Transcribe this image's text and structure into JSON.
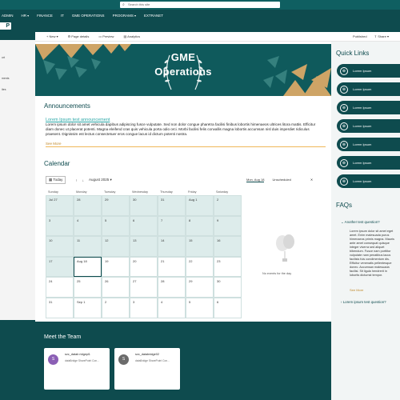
{
  "topbar": {
    "search_placeholder": "Search this site"
  },
  "nav": {
    "items": [
      "ADMIN",
      "HR",
      "FINANCE",
      "IT",
      "GME OPERATIONS",
      "PROGRAMS",
      "EXTRANET"
    ]
  },
  "logo": {
    "text": "P"
  },
  "left": {
    "items": [
      "ort",
      "ments",
      "ites"
    ]
  },
  "command_bar": {
    "new": "New",
    "page_details": "Page details",
    "preview": "Preview",
    "analytics": "Analytics",
    "published": "Published",
    "share": "Share"
  },
  "hero": {
    "title_line1": "GME",
    "title_line2": "Operations"
  },
  "announcements": {
    "heading": "Announcements",
    "post_title": "Lorem Ipsum test announcement",
    "post_body": "Lorem ipsum dolor sit amet vehicula dapibus adipiscing fusce vulputate. Sed non dolor congue pharetra facilisi finibus lobortis himenaeos ultrices litora mattis. Efficitur diam donec ut placerat potenti. Magna eleifend cras quis vehicula porta odio orci. Morbi facilisi felis convallis magna lobortis accumsan nisl duis imperdiet ridiculus praesent. Dignissim est lectus consectetuer eros congue lacus id dictum potenti nostra.",
    "see_more": "See More"
  },
  "calendar": {
    "heading": "Calendar",
    "today": "Today",
    "month": "August 2025",
    "days": [
      "Sunday",
      "Monday",
      "Tuesday",
      "Wednesday",
      "Thursday",
      "Friday",
      "Saturday"
    ],
    "weeks": [
      [
        "Jul 27",
        "28",
        "29",
        "30",
        "31",
        "Aug 1",
        "2"
      ],
      [
        "3",
        "4",
        "5",
        "6",
        "7",
        "8",
        "9"
      ],
      [
        "10",
        "11",
        "12",
        "13",
        "14",
        "15",
        "16"
      ],
      [
        "17",
        "Aug 18",
        "19",
        "20",
        "21",
        "22",
        "23"
      ],
      [
        "24",
        "25",
        "26",
        "27",
        "28",
        "29",
        "30"
      ],
      [
        "31",
        "Sep 1",
        "2",
        "3",
        "4",
        "5",
        "6"
      ]
    ],
    "tab_date": "Mon, Aug 18",
    "tab_unscheduled": "Unscheduled",
    "no_events": "No events for the day"
  },
  "team": {
    "heading": "Meet the Team",
    "members": [
      {
        "initial": "S",
        "name": "svc_datab ridgepl1",
        "sub": "dataBridge SharePoint Con...",
        "color": "#8b5fb5"
      },
      {
        "initial": "S",
        "name": "svc_databridge02",
        "sub": "dataBridge SharePoint Con...",
        "color": "#6b6b6b"
      }
    ]
  },
  "quick_links": {
    "heading": "Quick Links",
    "items": [
      "Lorem Ipsum",
      "Lorem Ipsum",
      "Lorem Ipsum",
      "Lorem Ipsum",
      "Lorem Ipsum",
      "Lorem Ipsum",
      "Lorem Ipsum"
    ]
  },
  "faqs": {
    "heading": "FAQs",
    "q1": "Another test question?",
    "a1": "Lorem ipsum dolor sit amet eget amet. Enim malesuada purus himenaeos primis magna. Mauris ante amet consequat quisque integer viverra sed aliquet bibendum. Fusce nam porttitor vulputate nam penatibus lacus facilisis fuis condimentum dis. Efficitur venenatis pellentesque donec. Accumsan malesuada facilisi. Sit ligula hendrerit in lobortis dictumst tempor.",
    "a1_more": "See More",
    "q2": "Lorem ipsum test question?"
  },
  "colors": {
    "brand_teal": "#0e4b4e",
    "accent_orange": "#c08a2c",
    "link_teal": "#2aa7a7"
  }
}
